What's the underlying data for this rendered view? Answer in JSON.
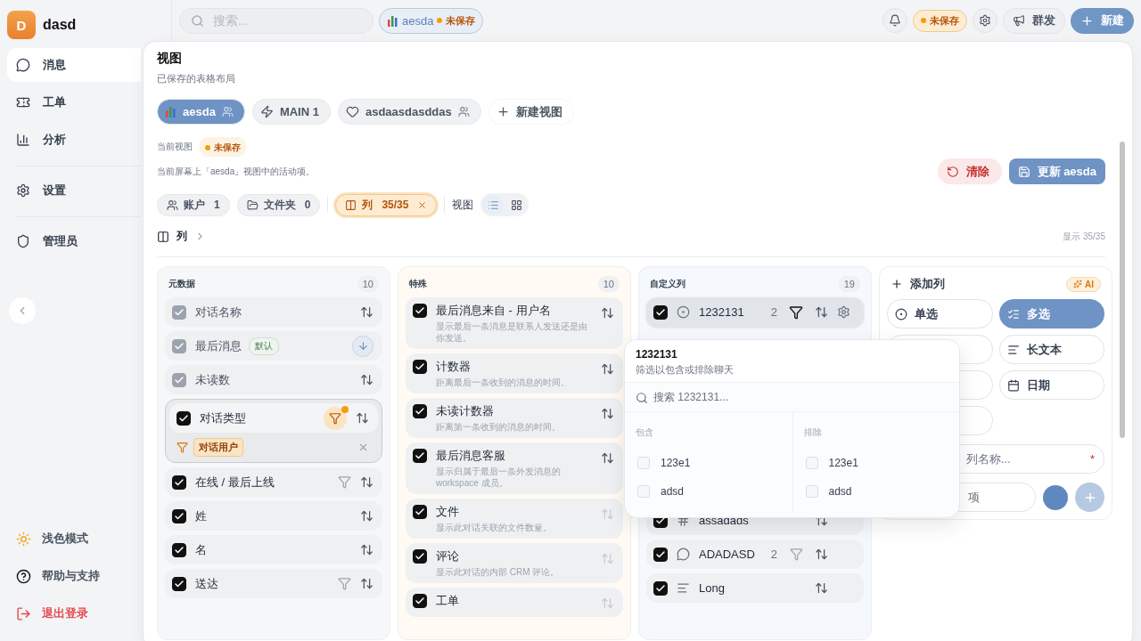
{
  "sidebar": {
    "workspace": {
      "initial": "D",
      "name": "dasd"
    },
    "nav": [
      {
        "label": "消息",
        "selected": true
      },
      {
        "label": "工单",
        "selected": false
      },
      {
        "label": "分析",
        "selected": false
      },
      {
        "label": "设置",
        "selected": false
      },
      {
        "label": "管理员",
        "selected": false
      }
    ],
    "footer": [
      {
        "label": "浅色模式",
        "danger": false
      },
      {
        "label": "帮助与支持",
        "danger": false
      },
      {
        "label": "退出登录",
        "danger": true
      }
    ]
  },
  "topbar": {
    "search": {
      "placeholder": "搜索..."
    },
    "view_chip": {
      "name": "aesda",
      "status": "未保存"
    },
    "status_badge": "未保存",
    "buttons": [
      "群发",
      "新建"
    ]
  },
  "panel": {
    "title": "视图",
    "subtitle": "已保存的表格布局",
    "views": [
      {
        "label": "aesda",
        "selected": true,
        "shared": true
      },
      {
        "label": "MAIN 1",
        "selected": false,
        "shared": false
      },
      {
        "label": "asdaasdasddas",
        "selected": false,
        "shared": true
      }
    ],
    "new_view": "新建视图",
    "current_label": "当前视图",
    "current_status": "未保存",
    "description": "当前屏幕上「aesda」视图中的活动项。",
    "clear_button": "清除",
    "update_button": "更新 aesda",
    "filters": [
      {
        "label": "账户",
        "count": "1",
        "active": false
      },
      {
        "label": "文件夹",
        "count": "0",
        "active": false
      },
      {
        "label": "列",
        "count": "35/35",
        "active": true
      }
    ],
    "view_label": "视图",
    "view_modes": [
      {
        "selected": true
      },
      {
        "selected": false
      }
    ],
    "breadcrumb": "列",
    "showing": "显示 35/35",
    "columns": [
      {
        "title": "元数据",
        "count": "10",
        "color": "#f6f7f9",
        "items": [
          {
            "label": "对话名称",
            "checked": true,
            "locked": true,
            "filterable": false,
            "filter_active": false,
            "sort_desc": false
          },
          {
            "label": "最后消息",
            "checked": true,
            "locked": true,
            "badge": "默认",
            "filterable": false,
            "filter_active": false,
            "sort_desc": true
          },
          {
            "label": "未读数",
            "checked": true,
            "locked": true,
            "filterable": false,
            "filter_active": false,
            "sort_desc": false
          },
          {
            "label": "对话类型",
            "checked": true,
            "locked": false,
            "filterable": true,
            "filter_active": true,
            "sort_desc": false,
            "filter_value": "对话用户"
          },
          {
            "label": "在线 / 最后上线",
            "checked": true,
            "locked": false,
            "filterable": true,
            "filter_active": false,
            "sort_desc": false
          },
          {
            "label": "姓",
            "checked": true,
            "locked": false,
            "filterable": false,
            "filter_active": false,
            "sort_desc": false
          },
          {
            "label": "名",
            "checked": true,
            "locked": false,
            "filterable": false,
            "filter_active": false,
            "sort_desc": false
          },
          {
            "label": "送达",
            "checked": true,
            "locked": false,
            "filterable": true,
            "filter_active": false,
            "sort_desc": false
          }
        ]
      },
      {
        "title": "特殊",
        "count": "10",
        "color": "#fffbf4",
        "items": [
          {
            "label": "最后消息来自 - 用户名",
            "description": "显示最后一条消息是联系人发送还是由你发送。",
            "checked": true,
            "sort_dim": false
          },
          {
            "label": "计数器",
            "description": "距离最后一条收到的消息的时间。",
            "checked": true,
            "sort_dim": false
          },
          {
            "label": "未读计数器",
            "description": "距离第一条收到的消息的时间。",
            "checked": true,
            "sort_dim": false
          },
          {
            "label": "最后消息客服",
            "description": "显示归属于最后一条外发消息的 workspace 成员。",
            "checked": true,
            "sort_dim": false
          },
          {
            "label": "文件",
            "description": "显示此对话关联的文件数量。",
            "checked": true,
            "sort_dim": true
          },
          {
            "label": "评论",
            "description": "显示此对话的内部 CRM 评论。",
            "checked": true,
            "sort_dim": true
          },
          {
            "label": "工单",
            "checked": true,
            "sort_dim": true
          }
        ]
      },
      {
        "title": "自定义列",
        "count": "19",
        "color": "#f5f9fd",
        "items": [
          {
            "label": "1232131",
            "kind": "single",
            "checked": true,
            "selected": true,
            "count": "2",
            "filterable": true,
            "filter_active": true,
            "settings": true
          },
          {
            "kind": "hidden"
          },
          {
            "label": "assadads",
            "kind": "number",
            "checked": true,
            "selected": false,
            "filterable": false,
            "filter_active": false,
            "settings": false
          },
          {
            "label": "ADADASD",
            "kind": "text",
            "checked": true,
            "selected": false,
            "count": "2",
            "filterable": true,
            "filter_active": false,
            "settings": false
          },
          {
            "label": "Long",
            "kind": "longtext",
            "checked": true,
            "selected": false,
            "filterable": false,
            "filter_active": false,
            "settings": false
          }
        ]
      }
    ],
    "add_column": {
      "title": "添加列",
      "ai_badge": "AI",
      "types": [
        {
          "label": "单选",
          "selected": false
        },
        {
          "label": "多选",
          "selected": true
        },
        {
          "selected": false
        },
        {
          "label": "长文本",
          "selected": false
        },
        {
          "selected": false
        },
        {
          "label": "日期",
          "selected": false
        },
        {
          "selected": false
        }
      ],
      "name_placeholder": "列名称...",
      "required_mark": "*",
      "option_placeholder": "项"
    },
    "popover": {
      "title": "1232131",
      "subtitle": "筛选以包含或排除聊天",
      "search_placeholder": "搜索 1232131...",
      "groups": [
        {
          "title": "包含",
          "options": [
            {
              "label": "123e1",
              "checked": false
            },
            {
              "label": "adsd",
              "checked": false
            }
          ]
        },
        {
          "title": "排除",
          "options": [
            {
              "label": "123e1",
              "checked": false
            },
            {
              "label": "adsd",
              "checked": false
            }
          ]
        }
      ]
    }
  }
}
